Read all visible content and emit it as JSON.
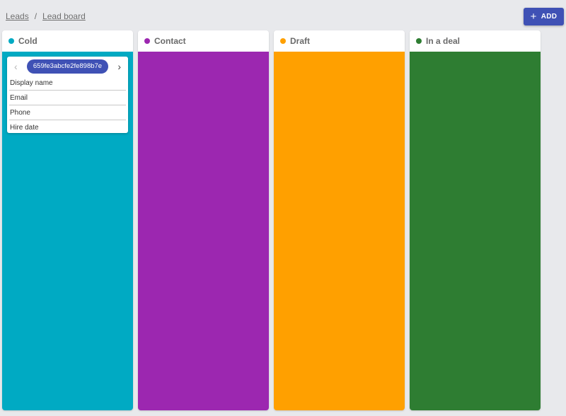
{
  "breadcrumb": {
    "items": [
      "Leads",
      "Lead board"
    ],
    "separator": "/"
  },
  "toolbar": {
    "add_label": "ADD",
    "add_icon": "plus-icon"
  },
  "columns": [
    {
      "title": "Cold",
      "color": "#00aac3",
      "card": {
        "id": "659fe3abcfe2fe898b7e",
        "fields": [
          "Display name",
          "Email",
          "Phone",
          "Hire date"
        ]
      }
    },
    {
      "title": "Contact",
      "color": "#9c27b0"
    },
    {
      "title": "Draft",
      "color": "#ffa000"
    },
    {
      "title": "In a deal",
      "color": "#2e7d32"
    }
  ],
  "colors": {
    "background": "#e8e9ec",
    "accent": "#3f51b5"
  }
}
